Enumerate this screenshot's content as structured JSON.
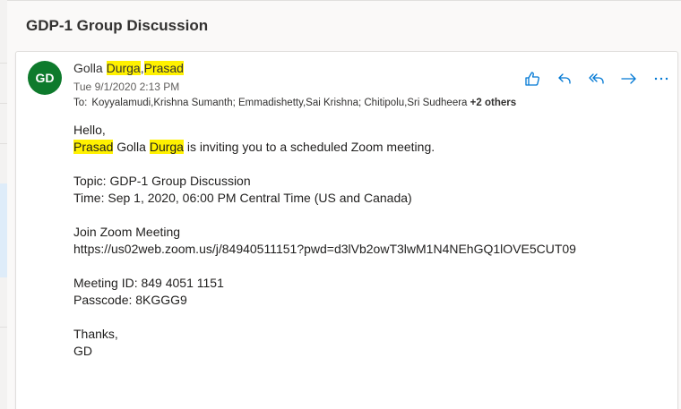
{
  "email": {
    "subject": "GDP-1 Group Discussion",
    "avatar_initials": "GD",
    "sender": {
      "part1": "Golla ",
      "part2": "Durga",
      "part3": ",",
      "part4": "Prasad"
    },
    "date": "Tue 9/1/2020 2:13 PM",
    "to_label": "To:",
    "recipients": "Koyyalamudi,Krishna Sumanth; Emmadishetty,Sai Krishna; Chitipolu,Sri Sudheera",
    "more_recipients": "+2 others",
    "body": {
      "greeting": "Hello,",
      "invite": {
        "name1": "Prasad",
        "mid": " Golla ",
        "name2": "Durga",
        "rest": " is inviting you to a scheduled Zoom meeting."
      },
      "topic": "Topic: GDP-1 Group Discussion",
      "time": "Time: Sep 1, 2020, 06:00 PM Central Time (US and Canada)",
      "join_label": "Join Zoom Meeting",
      "join_link": "https://us02web.zoom.us/j/84940511151?pwd=d3lVb2owT3lwM1N4NEhGQ1lOVE5CUT09",
      "meeting_id": "Meeting ID: 849 4051 1151",
      "passcode": "Passcode: 8KGGG9",
      "thanks": "Thanks,",
      "signature": "GD"
    }
  },
  "actions": [
    {
      "icon": "like-icon"
    },
    {
      "icon": "reply-icon"
    },
    {
      "icon": "reply-all-icon"
    },
    {
      "icon": "forward-icon"
    },
    {
      "icon": "more-icon"
    }
  ],
  "colors": {
    "accent": "#0078d4",
    "avatar": "#0e7a2c",
    "highlight": "#fff100"
  }
}
